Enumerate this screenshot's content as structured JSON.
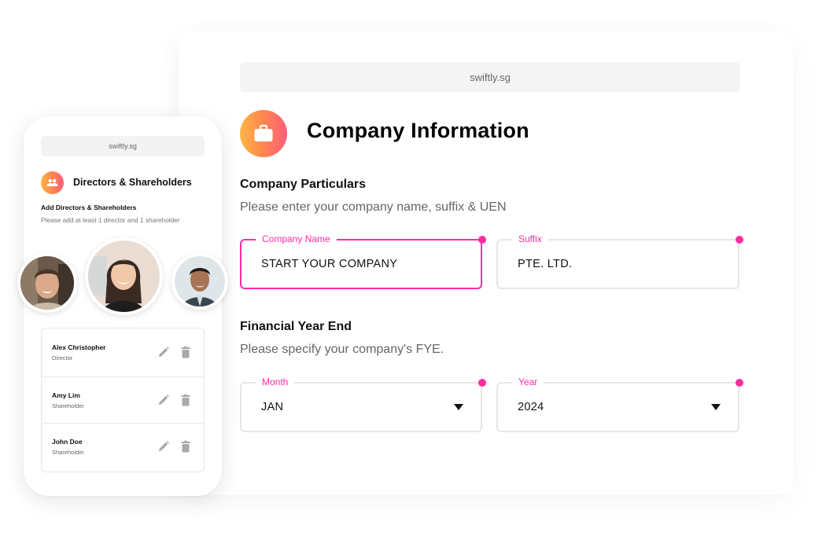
{
  "desktop": {
    "url": "swiftly.sg",
    "page_title": "Company Information",
    "hero_icon": "briefcase-icon",
    "accent_color": "#ff2da0",
    "gradient_colors": [
      "#ffb547",
      "#ff5e7a"
    ],
    "particulars": {
      "title": "Company Particulars",
      "subtitle": "Please enter your company name, suffix & UEN",
      "company_name": {
        "label": "Company Name",
        "value": "START YOUR COMPANY",
        "focused": true
      },
      "suffix": {
        "label": "Suffix",
        "value": "PTE. LTD."
      }
    },
    "fye": {
      "title": "Financial Year End",
      "subtitle": "Please specify your company's FYE.",
      "month": {
        "label": "Month",
        "value": "JAN",
        "icon": "caret-down-icon"
      },
      "year": {
        "label": "Year",
        "value": "2024",
        "icon": "caret-down-icon"
      }
    }
  },
  "phone": {
    "url": "swiftly.sg",
    "header_icon": "people-icon",
    "title": "Directors & Shareholders",
    "section_title": "Add Directors & Shareholders",
    "section_desc": "Please add at least 1 director and 1 shareholder",
    "avatars": [
      "avatar-man-smiling",
      "avatar-woman-smiling",
      "avatar-man-glasses"
    ],
    "people": [
      {
        "name": "Alex Christopher",
        "role": "Director"
      },
      {
        "name": "Amy Lim",
        "role": "Shareholder"
      },
      {
        "name": "John Doe",
        "role": "Shareholder"
      }
    ],
    "row_actions": [
      "edit-icon",
      "delete-icon"
    ]
  }
}
